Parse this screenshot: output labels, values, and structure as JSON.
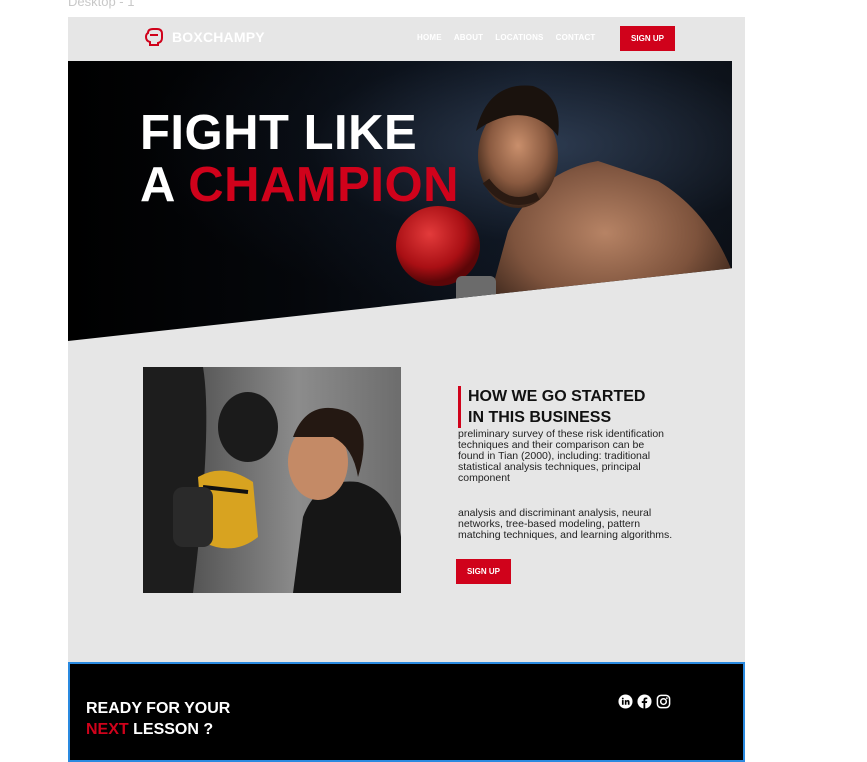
{
  "frame_label": "Desktop - 1",
  "brand": {
    "name": "BOXCHAMPY",
    "accent_color": "#d0021b"
  },
  "header": {
    "nav": [
      {
        "label": "HOME"
      },
      {
        "label": "ABOUT"
      },
      {
        "label": "LOCATIONS"
      },
      {
        "label": "CONTACT"
      }
    ],
    "signup_label": "SIGN UP"
  },
  "hero": {
    "line1": "FIGHT LIKE",
    "line2_prefix": "A ",
    "line2_highlight": "CHAMPION"
  },
  "about": {
    "heading_line1": "HOW WE GO STARTED",
    "heading_line2": "IN THIS BUSINESS",
    "paragraph1": "preliminary survey of these risk identification techniques and their comparison can be found in Tian (2000), including: traditional statistical analysis techniques, principal component",
    "paragraph2": "analysis and discriminant analysis, neural networks, tree-based modeling, pattern matching techniques, and learning algorithms.",
    "signup_label": "SIGN UP"
  },
  "footer": {
    "title_line1": "READY FOR YOUR",
    "title_highlight": "NEXT",
    "title_rest": " LESSON ?",
    "socials": [
      "linkedin-icon",
      "facebook-icon",
      "instagram-icon"
    ]
  }
}
